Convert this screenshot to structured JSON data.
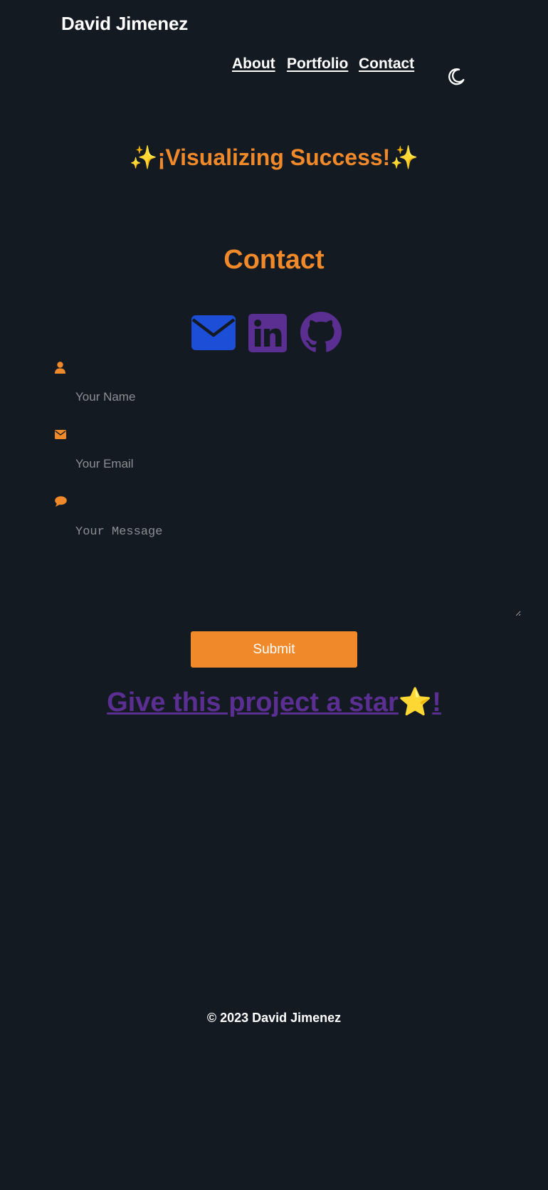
{
  "header": {
    "site_name": "David Jimenez",
    "nav": [
      {
        "label": "About"
      },
      {
        "label": "Portfolio"
      },
      {
        "label": "Contact"
      }
    ],
    "theme_toggle_icon": "moon-icon"
  },
  "hero": {
    "sparkle_left": "✨",
    "tagline": "¡Visualizing Success!",
    "sparkle_right": "✨"
  },
  "contact": {
    "title": "Contact",
    "social_icons": [
      {
        "name": "envelope-icon",
        "color": "#1d4ed8"
      },
      {
        "name": "linkedin-icon",
        "color": "#5b2f92"
      },
      {
        "name": "github-icon",
        "color": "#5b2f92"
      }
    ],
    "form": {
      "name_icon": "user-icon",
      "name_placeholder": "Your Name",
      "name_value": "",
      "email_icon": "envelope-icon",
      "email_placeholder": "Your Email",
      "email_value": "",
      "message_icon": "speech-bubble-icon",
      "message_placeholder": "Your Message",
      "message_value": "",
      "submit_label": "Submit"
    }
  },
  "star_link": {
    "label": "Give this project a star",
    "emoji": "⭐",
    "suffix": "!"
  },
  "footer": {
    "copyright": "© 2023 David Jimenez"
  },
  "colors": {
    "background": "#141a22",
    "accent": "#f0892a",
    "purple": "#5b2f92",
    "blue": "#1d4ed8",
    "text": "#ffffff"
  }
}
